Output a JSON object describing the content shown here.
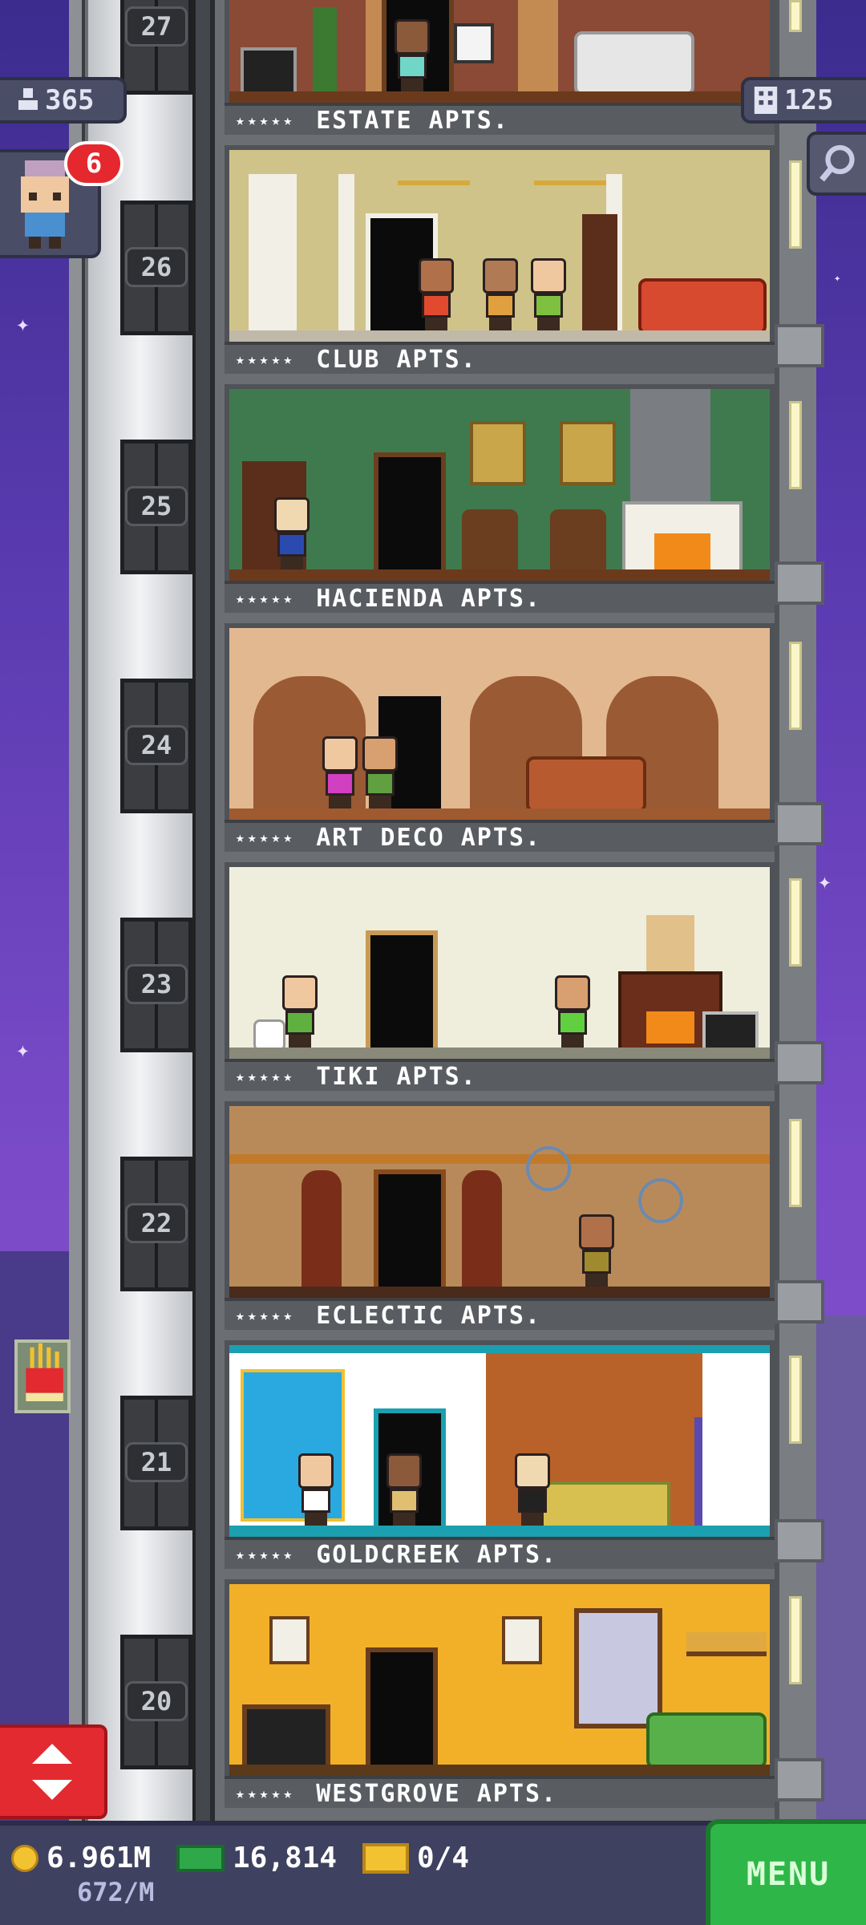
{
  "hud": {
    "population": "365",
    "floor_count": "125",
    "visitor_notification_count": "6"
  },
  "floors": [
    {
      "number": "27",
      "name": "ESTATE APTS.",
      "stars": "★★★★★"
    },
    {
      "number": "26",
      "name": "CLUB APTS.",
      "stars": "★★★★★"
    },
    {
      "number": "25",
      "name": "HACIENDA APTS.",
      "stars": "★★★★★"
    },
    {
      "number": "24",
      "name": "ART DECO APTS.",
      "stars": "★★★★★"
    },
    {
      "number": "23",
      "name": "TIKI APTS.",
      "stars": "★★★★★"
    },
    {
      "number": "22",
      "name": "ECLECTIC APTS.",
      "stars": "★★★★★"
    },
    {
      "number": "21",
      "name": "GOLDCREEK APTS.",
      "stars": "★★★★★"
    },
    {
      "number": "20",
      "name": "WESTGROVE APTS.",
      "stars": "★★★★★"
    }
  ],
  "bottom_bar": {
    "coins": "6.961M",
    "coin_rate": "672/M",
    "bux": "16,814",
    "tickets": "0/4",
    "menu_label": "MENU"
  },
  "colors": {
    "menu_green": "#2fb648",
    "elevator_red": "#e22a30",
    "notification_red": "#e4282e",
    "hud_panel": "#4a4d66"
  },
  "icons": {
    "population": "person-icon",
    "floors": "building-icon",
    "search": "magnifier-icon",
    "coins": "coin-icon",
    "bux": "banknote-icon",
    "tickets": "ticket-icon",
    "elevator": "up-down-arrows-icon",
    "ad": "fries-icon"
  }
}
